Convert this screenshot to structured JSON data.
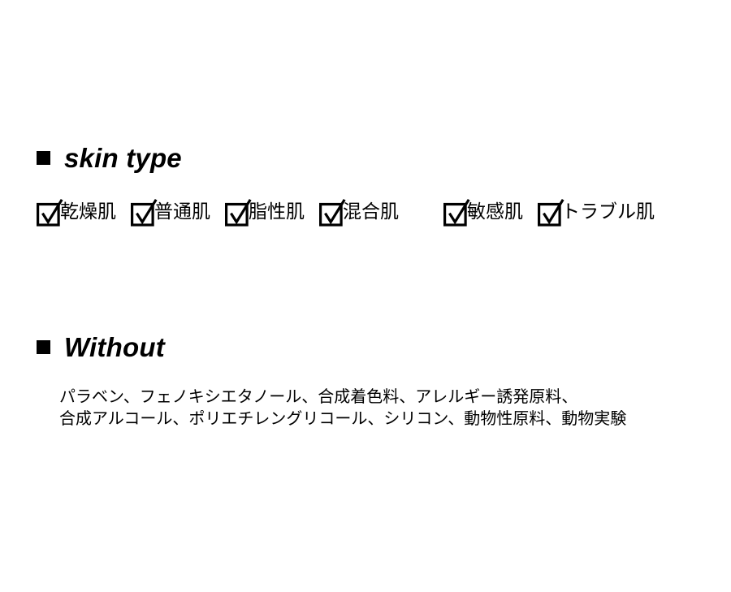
{
  "page": {
    "background_color": "#ffffff",
    "text_color": "#000000"
  },
  "sections": {
    "skin_type": {
      "bullet": "black-square-bullet",
      "heading": "skin type",
      "checkboxes": [
        {
          "label": "乾燥肌",
          "checked": true,
          "icon": "checked-checkbox-icon"
        },
        {
          "label": "普通肌",
          "checked": true,
          "icon": "checked-checkbox-icon"
        },
        {
          "label": "脂性肌",
          "checked": true,
          "icon": "checked-checkbox-icon"
        },
        {
          "label": "混合肌",
          "checked": true,
          "icon": "checked-checkbox-icon"
        },
        {
          "label": "敏感肌",
          "checked": true,
          "icon": "checked-checkbox-icon"
        },
        {
          "label": "トラブル肌",
          "checked": true,
          "icon": "checked-checkbox-icon"
        }
      ]
    },
    "without": {
      "bullet": "black-square-bullet",
      "heading": "Without",
      "lines": [
        "パラベン、フェノキシエタノール、合成着色料、アレルギー誘発原料、",
        "合成アルコール、ポリエチレングリコール、シリコン、動物性原料、動物実験"
      ]
    }
  }
}
